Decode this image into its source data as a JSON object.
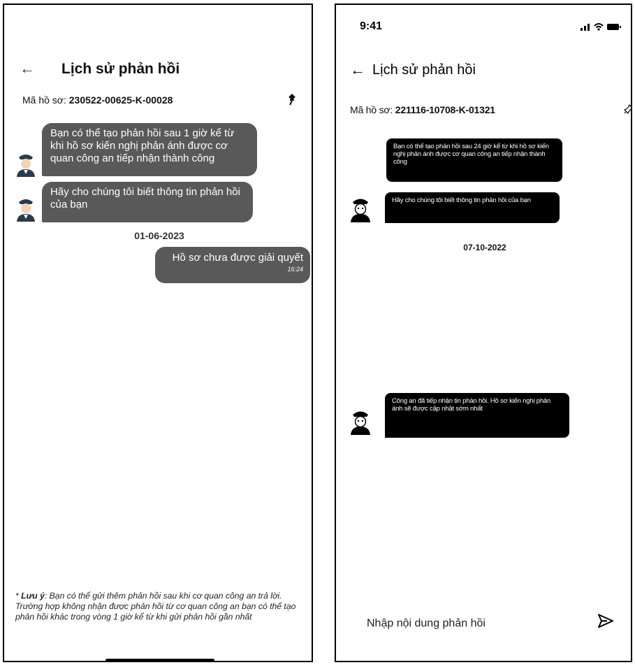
{
  "screenA": {
    "title": "Lịch sử phản hồi",
    "case_label": "Mã hồ sơ: ",
    "case_id": "230522-00625-K-00028",
    "messages": [
      "Bạn có thể tạo phản hồi sau 1 giờ kể từ khi hồ sơ kiến nghị phản ánh được cơ quan công an tiếp nhận thành công",
      "Hãy cho chúng tôi biết thông tin phản hồi của bạn"
    ],
    "date": "01-06-2023",
    "sent": {
      "text": "Hồ sơ chưa được giải quyết",
      "time": "16:24"
    },
    "note_label": "Lưu ý",
    "note_text": ": Bạn có thể gửi thêm phản hồi sau khi cơ quan công an trả lời. Trường hợp không nhận được phản hồi từ cơ quan công an bạn có thể tạo phản hồi khác trong vòng 1 giờ kể từ khi gửi phản hồi gần nhất"
  },
  "screenB": {
    "status_time": "9:41",
    "title": "Lịch sử phản hồi",
    "case_label": "Mã hồ sơ: ",
    "case_id": "221116-10708-K-01321",
    "messages": [
      "Bạn có thể tạo phản hồi sau 24 giờ kể từ khi hồ sơ kiến nghị phản ánh được cơ quan công an tiếp nhận thành công",
      "Hãy cho chúng tôi biết thông tin phản hồi của bạn",
      "Công an đã tiếp nhận tin phản hồi. Hồ sơ kiến nghị phản ánh sẽ được cập nhật sớm nhất"
    ],
    "date": "07-10-2022",
    "input_placeholder": "Nhập nội dung phản hồi"
  },
  "colors": {
    "bubble_gray": "#595959",
    "bubble_black": "#000000"
  },
  "icons": [
    "back-arrow-icon",
    "pin-icon",
    "officer-avatar-icon",
    "signal-icon",
    "wifi-icon",
    "battery-icon",
    "send-icon"
  ]
}
